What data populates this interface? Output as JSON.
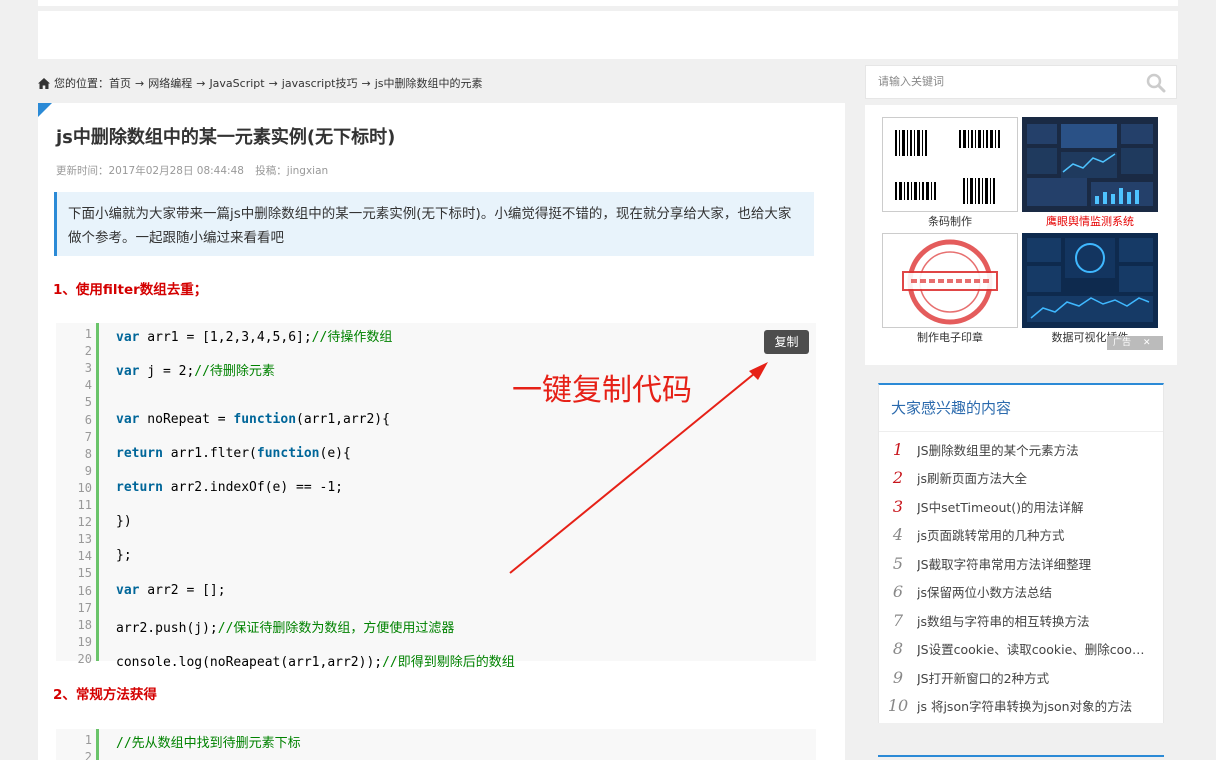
{
  "breadcrumb": {
    "prefix": "您的位置：",
    "items": [
      "首页",
      "网络编程",
      "JavaScript",
      "javascript技巧",
      "js中删除数组中的元素"
    ],
    "separator": "→"
  },
  "article": {
    "title": "js中删除数组中的某一元素实例(无下标时)",
    "update_time": "更新时间：2017年02月28日 08:44:48",
    "author": "投稿：jingxian",
    "intro": "下面小编就为大家带来一篇js中删除数组中的某一元素实例(无下标时)。小编觉得挺不错的，现在就分享给大家，也给大家做个参考。一起跟随小编过来看看吧",
    "section1": "1、使用filter数组去重；",
    "section2": "2、常规方法获得",
    "copy_label": "复制",
    "annotation": "一键复制代码",
    "code1": [
      {
        "n": "1",
        "t": "var arr1 = [1,2,3,4,5,6];//待操作数组"
      },
      {
        "n": "2",
        "t": ""
      },
      {
        "n": "3",
        "t": "var j = 2;//待删除元素"
      },
      {
        "n": "4",
        "t": ""
      },
      {
        "n": "5",
        "t": ""
      },
      {
        "n": "6",
        "t": "var noRepeat = function(arr1,arr2){"
      },
      {
        "n": "7",
        "t": ""
      },
      {
        "n": "8",
        "t": "return arr1.flter(function(e){"
      },
      {
        "n": "9",
        "t": ""
      },
      {
        "n": "10",
        "t": "return arr2.indexOf(e) == -1;"
      },
      {
        "n": "11",
        "t": ""
      },
      {
        "n": "12",
        "t": "})"
      },
      {
        "n": "13",
        "t": ""
      },
      {
        "n": "14",
        "t": "};"
      },
      {
        "n": "15",
        "t": ""
      },
      {
        "n": "16",
        "t": "var arr2 = [];"
      },
      {
        "n": "17",
        "t": ""
      },
      {
        "n": "18",
        "t": "arr2.push(j);//保证待删除数为数组，方便使用过滤器"
      },
      {
        "n": "19",
        "t": ""
      },
      {
        "n": "20",
        "t": "console.log(noReapeat(arr1,arr2));//即得到剔除后的数组"
      }
    ],
    "code2": [
      {
        "n": "1",
        "t": "//先从数组中找到待删元素下标"
      },
      {
        "n": "2",
        "t": ""
      }
    ]
  },
  "sidebar": {
    "search_placeholder": "请输入关键词",
    "ads": [
      {
        "caption": "条码制作",
        "red": false
      },
      {
        "caption": "鹰眼舆情监测系统",
        "red": true
      },
      {
        "caption": "制作电子印章",
        "red": false
      },
      {
        "caption": "数据可视化插件",
        "red": false
      }
    ],
    "ad_close": "广告",
    "hot_title": "大家感兴趣的内容",
    "hot_items": [
      {
        "num": "1",
        "text": "JS删除数组里的某个元素方法"
      },
      {
        "num": "2",
        "text": "js刷新页面方法大全"
      },
      {
        "num": "3",
        "text": "JS中setTimeout()的用法详解"
      },
      {
        "num": "4",
        "text": "js页面跳转常用的几种方式"
      },
      {
        "num": "5",
        "text": "JS截取字符串常用方法详细整理"
      },
      {
        "num": "6",
        "text": "js保留两位小数方法总结"
      },
      {
        "num": "7",
        "text": "js数组与字符串的相互转换方法"
      },
      {
        "num": "8",
        "text": "JS设置cookie、读取cookie、删除cookie"
      },
      {
        "num": "9",
        "text": "JS打开新窗口的2种方式"
      },
      {
        "num": "10",
        "text": "js 将json字符串转换为json对象的方法"
      }
    ]
  }
}
